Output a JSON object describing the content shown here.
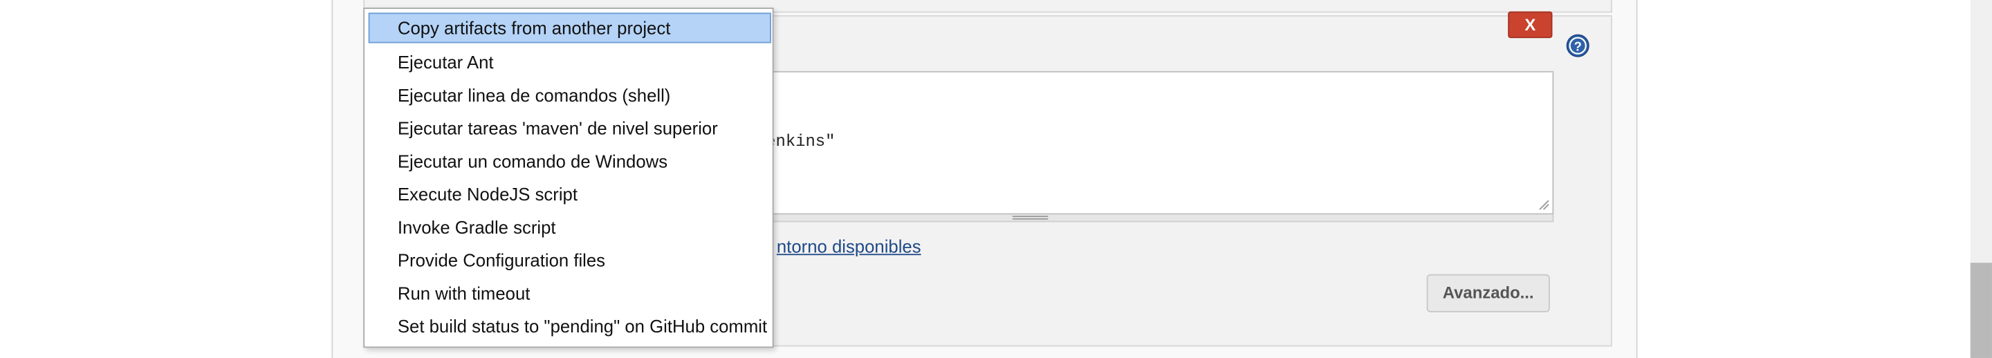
{
  "build_step": {
    "delete_label": "X",
    "command_text": "Jenkins\"",
    "env_vars_link": "ntorno disponibles",
    "advanced_label": "Avanzado..."
  },
  "menu": {
    "items": [
      {
        "label": "Copy artifacts from another project",
        "selected": true
      },
      {
        "label": "Ejecutar Ant"
      },
      {
        "label": "Ejecutar linea de comandos (shell)"
      },
      {
        "label": "Ejecutar tareas 'maven' de nivel superior"
      },
      {
        "label": "Ejecutar un comando de Windows"
      },
      {
        "label": "Execute NodeJS script"
      },
      {
        "label": "Invoke Gradle script"
      },
      {
        "label": "Provide Configuration files"
      },
      {
        "label": "Run with timeout"
      },
      {
        "label": "Set build status to \"pending\" on GitHub commit"
      }
    ]
  },
  "colors": {
    "delete_button": "#c9432f",
    "selected_item": "#b4d3f7",
    "help_icon": "#2f62a8",
    "link": "#204a87"
  },
  "icons": {
    "help": "help-icon",
    "resize": "resize-grip-icon"
  }
}
